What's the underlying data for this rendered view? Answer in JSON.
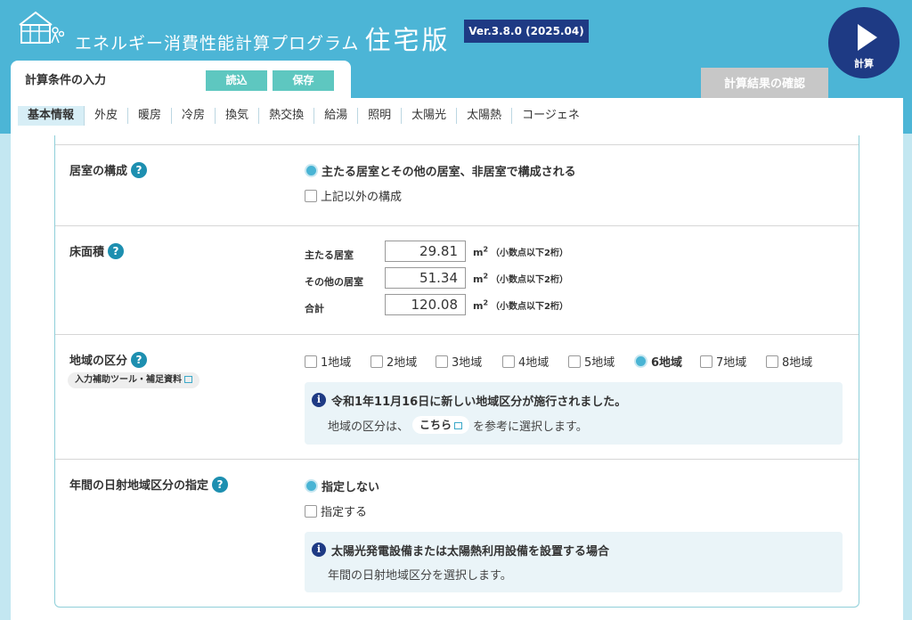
{
  "header": {
    "title": "エネルギー消費性能計算プログラム",
    "title_suffix": "住宅版",
    "version": "Ver.3.8.0 (2025.04)",
    "calc_label": "計算"
  },
  "input_tab": {
    "title": "計算条件の入力",
    "load_label": "読込",
    "save_label": "保存"
  },
  "result_tab": {
    "label": "計算結果の確認"
  },
  "tabs": [
    "基本情報",
    "外皮",
    "暖房",
    "冷房",
    "換気",
    "熱交換",
    "給湯",
    "照明",
    "太陽光",
    "太陽熱",
    "コージェネ"
  ],
  "active_tab": "基本情報",
  "sections": {
    "room_config": {
      "label": "居室の構成",
      "options": [
        {
          "label": "主たる居室とその他の居室、非居室で構成される",
          "selected": true
        },
        {
          "label": "上記以外の構成",
          "selected": false
        }
      ]
    },
    "floor_area": {
      "label": "床面積",
      "rows": [
        {
          "label": "主たる居室",
          "value": "29.81"
        },
        {
          "label": "その他の居室",
          "value": "51.34"
        },
        {
          "label": "合計",
          "value": "120.08"
        }
      ],
      "unit": "m",
      "unit_sup": "2",
      "note": "（小数点以下2桁）"
    },
    "region": {
      "label": "地域の区分",
      "helper": "入力補助ツール・補足資料",
      "options": [
        {
          "label": "1地域",
          "selected": false
        },
        {
          "label": "2地域",
          "selected": false
        },
        {
          "label": "3地域",
          "selected": false
        },
        {
          "label": "4地域",
          "selected": false
        },
        {
          "label": "5地域",
          "selected": false
        },
        {
          "label": "6地域",
          "selected": true
        },
        {
          "label": "7地域",
          "selected": false
        },
        {
          "label": "8地域",
          "selected": false
        }
      ],
      "info_title": "令和1年11月16日に新しい地域区分が施行されました。",
      "info_pre": "地域の区分は、",
      "info_link": "こちら",
      "info_post": "を参考に選択します。"
    },
    "solar_region": {
      "label": "年間の日射地域区分の指定",
      "options": [
        {
          "label": "指定しない",
          "selected": true
        },
        {
          "label": "指定する",
          "selected": false
        }
      ],
      "info_title": "太陽光発電設備または太陽熱利用設備を設置する場合",
      "info_text": "年間の日射地域区分を選択します。"
    }
  }
}
